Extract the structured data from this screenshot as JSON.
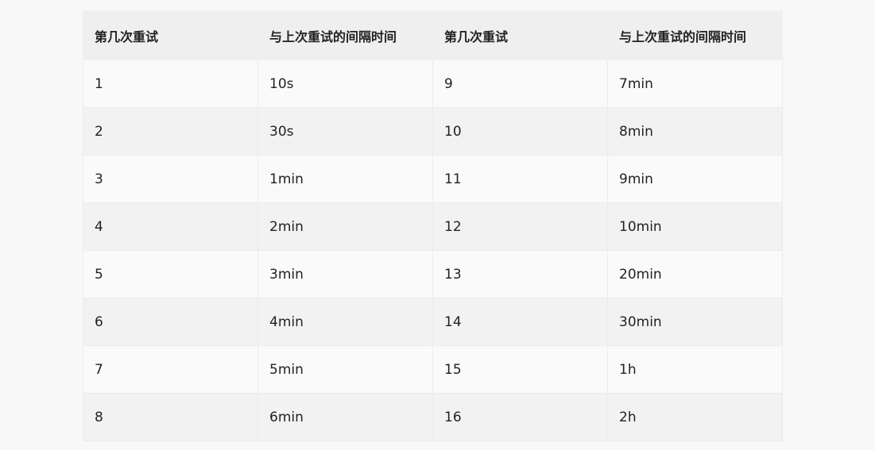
{
  "table": {
    "headers": [
      "第几次重试",
      "与上次重试的间隔时间",
      "第几次重试",
      "与上次重试的间隔时间"
    ],
    "rows": [
      [
        "1",
        "10s",
        "9",
        "7min"
      ],
      [
        "2",
        "30s",
        "10",
        "8min"
      ],
      [
        "3",
        "1min",
        "11",
        "9min"
      ],
      [
        "4",
        "2min",
        "12",
        "10min"
      ],
      [
        "5",
        "3min",
        "13",
        "20min"
      ],
      [
        "6",
        "4min",
        "14",
        "30min"
      ],
      [
        "7",
        "5min",
        "15",
        "1h"
      ],
      [
        "8",
        "6min",
        "16",
        "2h"
      ]
    ]
  }
}
